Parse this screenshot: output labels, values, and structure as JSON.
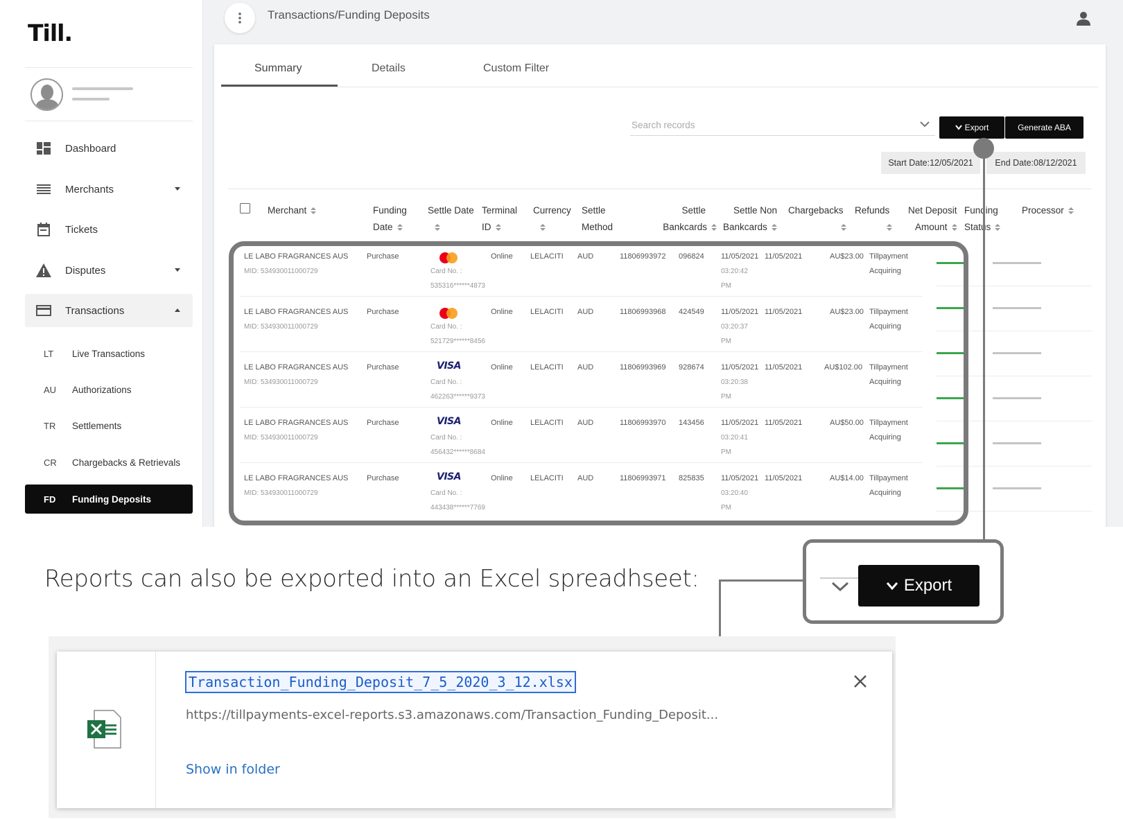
{
  "app": {
    "logo": "Till."
  },
  "breadcrumb": "Transactions/Funding Deposits",
  "sidebar": {
    "items": [
      {
        "label": "Dashboard",
        "icon": "dashboard-icon"
      },
      {
        "label": "Merchants",
        "icon": "list-icon"
      },
      {
        "label": "Tickets",
        "icon": "calendar-icon"
      },
      {
        "label": "Disputes",
        "icon": "warning-icon"
      },
      {
        "label": "Transactions",
        "icon": "card-icon"
      }
    ],
    "subitems": [
      {
        "abbr": "LT",
        "label": "Live Transactions"
      },
      {
        "abbr": "AU",
        "label": "Authorizations"
      },
      {
        "abbr": "TR",
        "label": "Settlements"
      },
      {
        "abbr": "CR",
        "label": "Chargebacks & Retrievals"
      },
      {
        "abbr": "FD",
        "label": "Funding Deposits"
      }
    ]
  },
  "tabs": [
    "Summary",
    "Details",
    "Custom Filter"
  ],
  "toolbar": {
    "search_placeholder": "Search records",
    "export_label": "Export",
    "generate_label": "Generate ABA",
    "start_date": "Start Date:12/05/2021",
    "end_date": "End Date:08/12/2021"
  },
  "table": {
    "headers": {
      "merchant": "Merchant",
      "funding_1": "Funding",
      "funding_2": "Date",
      "settle_date": "Settle Date",
      "terminal_1": "Terminal",
      "terminal_2": "ID",
      "currency": "Currency",
      "settle_method_1": "Settle",
      "settle_method_2": "Method",
      "settle_bank_1": "Settle",
      "settle_bank_2": "Bankcards",
      "settle_non_1": "Settle Non",
      "settle_non_2": "Bankcards",
      "chargebacks": "Chargebacks",
      "refunds": "Refunds",
      "net_1": "Net Deposit",
      "net_2": "Amount",
      "status_1": "Funding",
      "status_2": "Status",
      "processor": "Processor"
    },
    "rows": [
      {
        "merchant": "LE LABO FRAGRANCES AUS",
        "mid": "MID: 534930011000729",
        "type": "Purchase",
        "card": "mastercard",
        "card_label": "Card No. :",
        "card_no": "535316******4873",
        "channel": "Online",
        "code": "LELACITI",
        "currency": "AUD",
        "ref": "11806993972",
        "auth": "096824",
        "date": "11/05/2021",
        "time": "03:20:42",
        "ampm": "PM",
        "settle": "11/05/2021",
        "amount": "AU$23.00",
        "proc_1": "Tillpayment",
        "proc_2": "Acquiring"
      },
      {
        "merchant": "LE LABO FRAGRANCES AUS",
        "mid": "MID: 534930011000729",
        "type": "Purchase",
        "card": "mastercard",
        "card_label": "Card No. :",
        "card_no": "521729******8456",
        "channel": "Online",
        "code": "LELACITI",
        "currency": "AUD",
        "ref": "11806993968",
        "auth": "424549",
        "date": "11/05/2021",
        "time": "03:20:37",
        "ampm": "PM",
        "settle": "11/05/2021",
        "amount": "AU$23.00",
        "proc_1": "Tillpayment",
        "proc_2": "Acquiring"
      },
      {
        "merchant": "LE LABO FRAGRANCES AUS",
        "mid": "MID: 534930011000729",
        "type": "Purchase",
        "card": "VISA",
        "card_label": "Card No. :",
        "card_no": "462263******9373",
        "channel": "Online",
        "code": "LELACITI",
        "currency": "AUD",
        "ref": "11806993969",
        "auth": "928674",
        "date": "11/05/2021",
        "time": "03:20:38",
        "ampm": "PM",
        "settle": "11/05/2021",
        "amount": "AU$102.00",
        "proc_1": "Tillpayment",
        "proc_2": "Acquiring"
      },
      {
        "merchant": "LE LABO FRAGRANCES AUS",
        "mid": "MID: 534930011000729",
        "type": "Purchase",
        "card": "VISA",
        "card_label": "Card No. :",
        "card_no": "456432******8684",
        "channel": "Online",
        "code": "LELACITI",
        "currency": "AUD",
        "ref": "11806993970",
        "auth": "143456",
        "date": "11/05/2021",
        "time": "03:20:41",
        "ampm": "PM",
        "settle": "11/05/2021",
        "amount": "AU$50.00",
        "proc_1": "Tillpayment",
        "proc_2": "Acquiring"
      },
      {
        "merchant": "LE LABO FRAGRANCES AUS",
        "mid": "MID: 534930011000729",
        "type": "Purchase",
        "card": "VISA",
        "card_label": "Card No. :",
        "card_no": "443438******7769",
        "channel": "Online",
        "code": "LELACITI",
        "currency": "AUD",
        "ref": "11806993971",
        "auth": "825835",
        "date": "11/05/2021",
        "time": "03:20:40",
        "ampm": "PM",
        "settle": "11/05/2021",
        "amount": "AU$14.00",
        "proc_1": "Tillpayment",
        "proc_2": "Acquiring"
      }
    ]
  },
  "caption": "Reports can also be exported into an Excel spreadhseet:",
  "zoom_export_label": "Export",
  "download": {
    "filename": "Transaction_Funding_Deposit_7_5_2020_3_12.xlsx",
    "url": "https://tillpayments-excel-reports.s3.amazonaws.com/Transaction_Funding_Deposit...",
    "show_in_folder": "Show in folder"
  },
  "colors": {
    "accent_dark": "#0d0d0d",
    "status_green": "#3aa64c",
    "callout_gray": "#7a7a7a",
    "link_blue": "#2a6fc4"
  }
}
